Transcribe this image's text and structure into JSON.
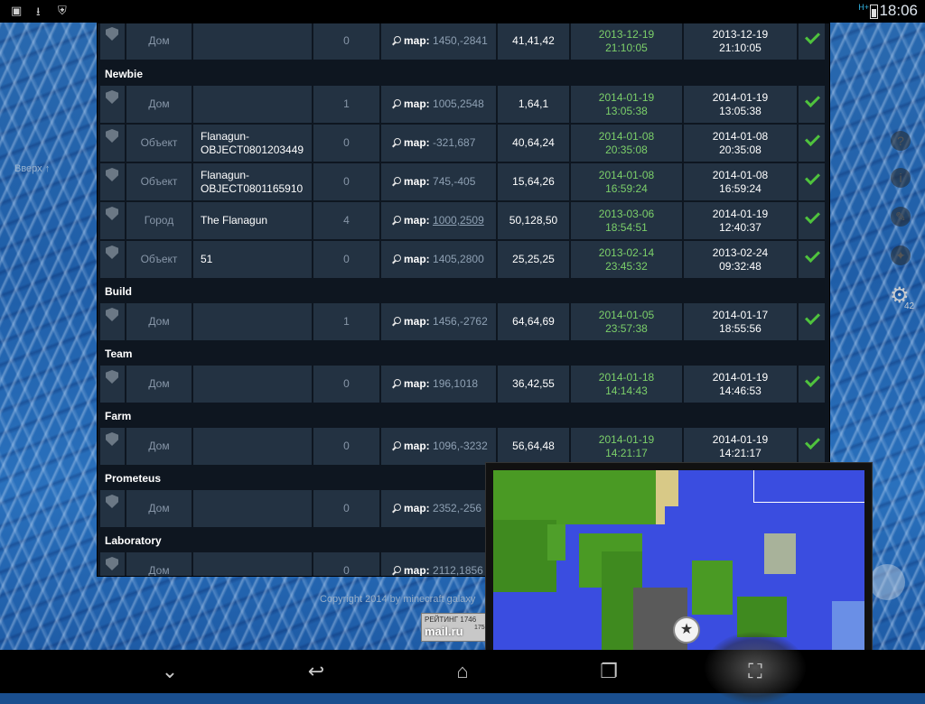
{
  "statusbar": {
    "time": "18:06",
    "network": "H+"
  },
  "side": {
    "up_link": "Вверх ↑",
    "gear_count": "42"
  },
  "footer": {
    "copyright": "Copyright 2014 by minecraft galaxy",
    "badge_line1": "РЕЙТИНГ 1746",
    "badge_line2": "mail.ru",
    "badge_line3": "175"
  },
  "map_label": "map:",
  "rows": [
    {
      "type": "Дом",
      "name": "",
      "count": "0",
      "coords": "1450,-2841",
      "size": "41,41,42",
      "created": [
        "2013-12-19",
        "21:10:05"
      ],
      "updated": [
        "2013-12-19",
        "21:10:05"
      ]
    },
    {
      "group": "Newbie"
    },
    {
      "type": "Дом",
      "name": "",
      "count": "1",
      "coords": "1005,2548",
      "size": "1,64,1",
      "created": [
        "2014-01-19",
        "13:05:38"
      ],
      "updated": [
        "2014-01-19",
        "13:05:38"
      ]
    },
    {
      "type": "Объект",
      "name": "Flanagun-OBJECT0801203449",
      "count": "0",
      "coords": "-321,687",
      "size": "40,64,24",
      "created": [
        "2014-01-08",
        "20:35:08"
      ],
      "updated": [
        "2014-01-08",
        "20:35:08"
      ]
    },
    {
      "type": "Объект",
      "name": "Flanagun-OBJECT0801165910",
      "count": "0",
      "coords": "745,-405",
      "size": "15,64,26",
      "created": [
        "2014-01-08",
        "16:59:24"
      ],
      "updated": [
        "2014-01-08",
        "16:59:24"
      ]
    },
    {
      "type": "Город",
      "name": "The Flanagun",
      "count": "4",
      "coords": "1000,2509",
      "link": true,
      "size": "50,128,50",
      "created": [
        "2013-03-06",
        "18:54:51"
      ],
      "updated": [
        "2014-01-19",
        "12:40:37"
      ]
    },
    {
      "type": "Объект",
      "name": "51",
      "count": "0",
      "coords": "1405,2800",
      "size": "25,25,25",
      "created": [
        "2013-02-14",
        "23:45:32"
      ],
      "updated": [
        "2013-02-24",
        "09:32:48"
      ]
    },
    {
      "group": "Build"
    },
    {
      "type": "Дом",
      "name": "",
      "count": "1",
      "coords": "1456,-2762",
      "size": "64,64,69",
      "created": [
        "2014-01-05",
        "23:57:38"
      ],
      "updated": [
        "2014-01-17",
        "18:55:56"
      ]
    },
    {
      "group": "Team"
    },
    {
      "type": "Дом",
      "name": "",
      "count": "0",
      "coords": "196,1018",
      "size": "36,42,55",
      "created": [
        "2014-01-18",
        "14:14:43"
      ],
      "updated": [
        "2014-01-19",
        "14:46:53"
      ]
    },
    {
      "group": "Farm"
    },
    {
      "type": "Дом",
      "name": "",
      "count": "0",
      "coords": "1096,-3232",
      "size": "56,64,48",
      "created": [
        "2014-01-19",
        "14:21:17"
      ],
      "updated": [
        "2014-01-19",
        "14:21:17"
      ]
    },
    {
      "group": "Prometeus"
    },
    {
      "type": "Дом",
      "name": "",
      "count": "0",
      "coords": "2352,-256",
      "size": "",
      "created": [
        "",
        ""
      ],
      "updated": [
        "",
        ""
      ]
    },
    {
      "group": "Laboratory"
    },
    {
      "type": "Дом",
      "name": "",
      "count": "0",
      "coords": "2112,1856",
      "size": "",
      "created": [
        "",
        ""
      ],
      "updated": [
        "",
        ""
      ]
    }
  ],
  "navbar": {
    "hide_icon": "chevron-down-icon",
    "back_icon": "back-icon",
    "home_icon": "home-icon",
    "recents_icon": "recents-icon",
    "screenshot_icon": "screenshot-icon"
  }
}
